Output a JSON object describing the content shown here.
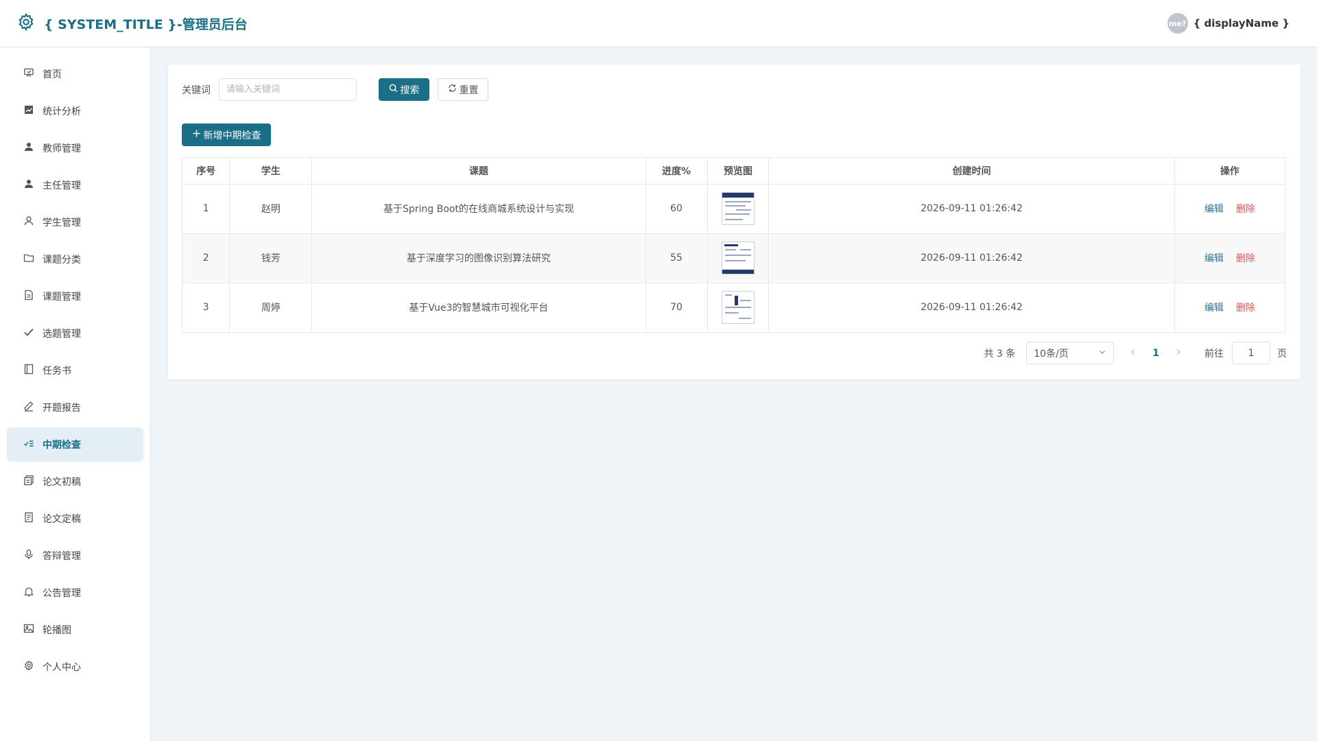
{
  "header": {
    "title": "{ SYSTEM_TITLE }-管理员后台",
    "avatar_text": "me?",
    "user_name": "{ displayName }"
  },
  "sidebar": {
    "items": [
      {
        "label": "首页",
        "icon": "home-icon"
      },
      {
        "label": "统计分析",
        "icon": "chart-icon"
      },
      {
        "label": "教师管理",
        "icon": "user-icon"
      },
      {
        "label": "主任管理",
        "icon": "user-icon"
      },
      {
        "label": "学生管理",
        "icon": "user-outline-icon"
      },
      {
        "label": "课题分类",
        "icon": "folder-icon"
      },
      {
        "label": "课题管理",
        "icon": "document-icon"
      },
      {
        "label": "选题管理",
        "icon": "check-icon"
      },
      {
        "label": "任务书",
        "icon": "book-icon"
      },
      {
        "label": "开题报告",
        "icon": "pen-icon"
      },
      {
        "label": "中期检查",
        "icon": "checklist-icon",
        "active": true
      },
      {
        "label": "论文初稿",
        "icon": "copy-icon"
      },
      {
        "label": "论文定稿",
        "icon": "document-icon"
      },
      {
        "label": "答辩管理",
        "icon": "microphone-icon"
      },
      {
        "label": "公告管理",
        "icon": "bell-icon"
      },
      {
        "label": "轮播图",
        "icon": "image-icon"
      },
      {
        "label": "个人中心",
        "icon": "gear-icon"
      }
    ]
  },
  "search": {
    "label": "关键词",
    "placeholder": "请输入关键词",
    "search_button": "搜索",
    "reset_button": "重置"
  },
  "add_button": "新增中期检查",
  "table": {
    "columns": [
      "序号",
      "学生",
      "课题",
      "进度%",
      "预览图",
      "创建时间",
      "操作"
    ],
    "rows": [
      {
        "index": "1",
        "student": "赵明",
        "topic": "基于Spring Boot的在线商城系统设计与实现",
        "progress": "60",
        "created": "2026-09-11 01:26:42"
      },
      {
        "index": "2",
        "student": "钱芳",
        "topic": "基于深度学习的图像识别算法研究",
        "progress": "55",
        "created": "2026-09-11 01:26:42"
      },
      {
        "index": "3",
        "student": "周婷",
        "topic": "基于Vue3的智慧城市可视化平台",
        "progress": "70",
        "created": "2026-09-11 01:26:42"
      }
    ],
    "edit_label": "编辑",
    "delete_label": "删除"
  },
  "pager": {
    "total": "共 3 条",
    "page_size": "10条/页",
    "current_page": "1",
    "goto_label": "前往",
    "goto_value": "1",
    "page_suffix": "页"
  },
  "colors": {
    "accent": "#1a6e86",
    "danger": "#e05050",
    "background": "#eff4f8"
  }
}
